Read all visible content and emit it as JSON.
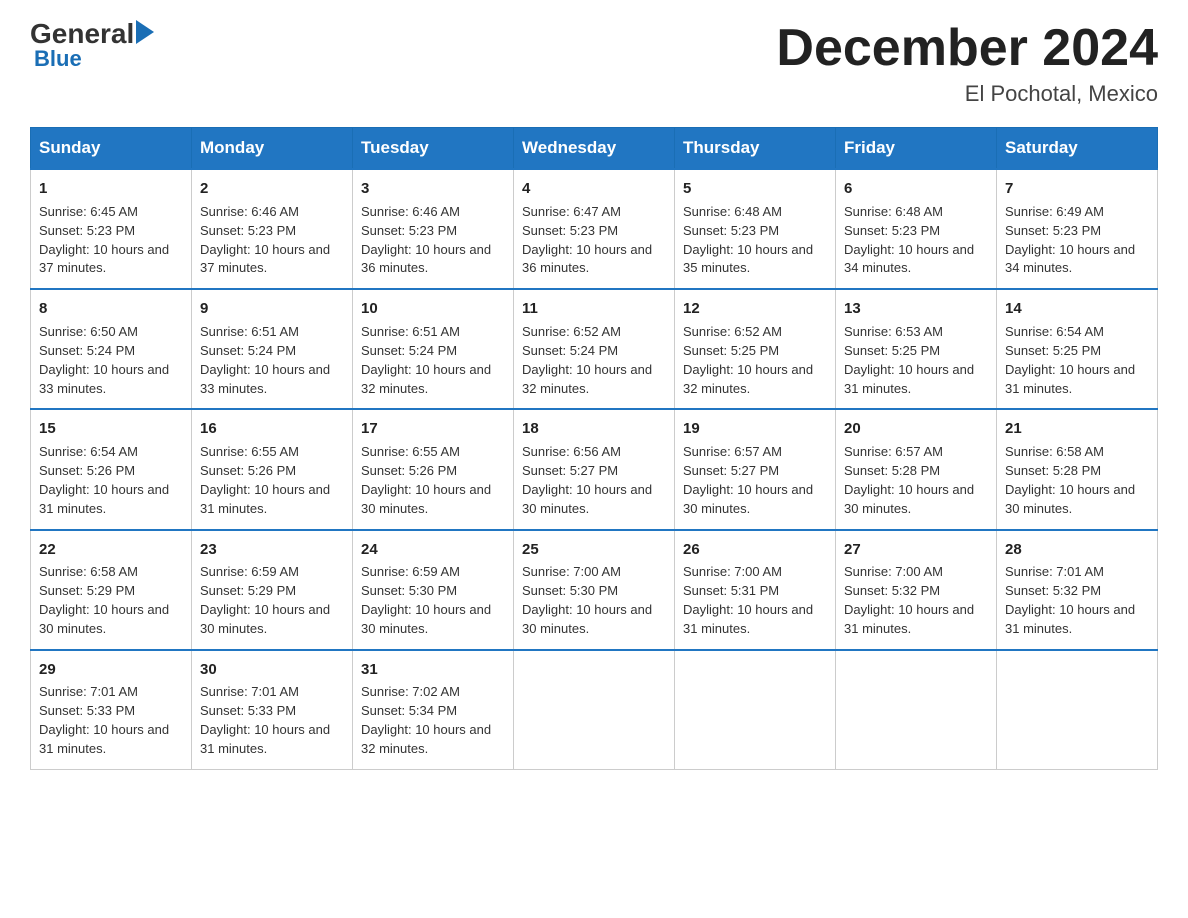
{
  "logo": {
    "general": "General",
    "blue": "Blue",
    "arrow": "▶"
  },
  "title": "December 2024",
  "location": "El Pochotal, Mexico",
  "days_of_week": [
    "Sunday",
    "Monday",
    "Tuesday",
    "Wednesday",
    "Thursday",
    "Friday",
    "Saturday"
  ],
  "weeks": [
    [
      {
        "day": "1",
        "sunrise": "6:45 AM",
        "sunset": "5:23 PM",
        "daylight": "10 hours and 37 minutes."
      },
      {
        "day": "2",
        "sunrise": "6:46 AM",
        "sunset": "5:23 PM",
        "daylight": "10 hours and 37 minutes."
      },
      {
        "day": "3",
        "sunrise": "6:46 AM",
        "sunset": "5:23 PM",
        "daylight": "10 hours and 36 minutes."
      },
      {
        "day": "4",
        "sunrise": "6:47 AM",
        "sunset": "5:23 PM",
        "daylight": "10 hours and 36 minutes."
      },
      {
        "day": "5",
        "sunrise": "6:48 AM",
        "sunset": "5:23 PM",
        "daylight": "10 hours and 35 minutes."
      },
      {
        "day": "6",
        "sunrise": "6:48 AM",
        "sunset": "5:23 PM",
        "daylight": "10 hours and 34 minutes."
      },
      {
        "day": "7",
        "sunrise": "6:49 AM",
        "sunset": "5:23 PM",
        "daylight": "10 hours and 34 minutes."
      }
    ],
    [
      {
        "day": "8",
        "sunrise": "6:50 AM",
        "sunset": "5:24 PM",
        "daylight": "10 hours and 33 minutes."
      },
      {
        "day": "9",
        "sunrise": "6:51 AM",
        "sunset": "5:24 PM",
        "daylight": "10 hours and 33 minutes."
      },
      {
        "day": "10",
        "sunrise": "6:51 AM",
        "sunset": "5:24 PM",
        "daylight": "10 hours and 32 minutes."
      },
      {
        "day": "11",
        "sunrise": "6:52 AM",
        "sunset": "5:24 PM",
        "daylight": "10 hours and 32 minutes."
      },
      {
        "day": "12",
        "sunrise": "6:52 AM",
        "sunset": "5:25 PM",
        "daylight": "10 hours and 32 minutes."
      },
      {
        "day": "13",
        "sunrise": "6:53 AM",
        "sunset": "5:25 PM",
        "daylight": "10 hours and 31 minutes."
      },
      {
        "day": "14",
        "sunrise": "6:54 AM",
        "sunset": "5:25 PM",
        "daylight": "10 hours and 31 minutes."
      }
    ],
    [
      {
        "day": "15",
        "sunrise": "6:54 AM",
        "sunset": "5:26 PM",
        "daylight": "10 hours and 31 minutes."
      },
      {
        "day": "16",
        "sunrise": "6:55 AM",
        "sunset": "5:26 PM",
        "daylight": "10 hours and 31 minutes."
      },
      {
        "day": "17",
        "sunrise": "6:55 AM",
        "sunset": "5:26 PM",
        "daylight": "10 hours and 30 minutes."
      },
      {
        "day": "18",
        "sunrise": "6:56 AM",
        "sunset": "5:27 PM",
        "daylight": "10 hours and 30 minutes."
      },
      {
        "day": "19",
        "sunrise": "6:57 AM",
        "sunset": "5:27 PM",
        "daylight": "10 hours and 30 minutes."
      },
      {
        "day": "20",
        "sunrise": "6:57 AM",
        "sunset": "5:28 PM",
        "daylight": "10 hours and 30 minutes."
      },
      {
        "day": "21",
        "sunrise": "6:58 AM",
        "sunset": "5:28 PM",
        "daylight": "10 hours and 30 minutes."
      }
    ],
    [
      {
        "day": "22",
        "sunrise": "6:58 AM",
        "sunset": "5:29 PM",
        "daylight": "10 hours and 30 minutes."
      },
      {
        "day": "23",
        "sunrise": "6:59 AM",
        "sunset": "5:29 PM",
        "daylight": "10 hours and 30 minutes."
      },
      {
        "day": "24",
        "sunrise": "6:59 AM",
        "sunset": "5:30 PM",
        "daylight": "10 hours and 30 minutes."
      },
      {
        "day": "25",
        "sunrise": "7:00 AM",
        "sunset": "5:30 PM",
        "daylight": "10 hours and 30 minutes."
      },
      {
        "day": "26",
        "sunrise": "7:00 AM",
        "sunset": "5:31 PM",
        "daylight": "10 hours and 31 minutes."
      },
      {
        "day": "27",
        "sunrise": "7:00 AM",
        "sunset": "5:32 PM",
        "daylight": "10 hours and 31 minutes."
      },
      {
        "day": "28",
        "sunrise": "7:01 AM",
        "sunset": "5:32 PM",
        "daylight": "10 hours and 31 minutes."
      }
    ],
    [
      {
        "day": "29",
        "sunrise": "7:01 AM",
        "sunset": "5:33 PM",
        "daylight": "10 hours and 31 minutes."
      },
      {
        "day": "30",
        "sunrise": "7:01 AM",
        "sunset": "5:33 PM",
        "daylight": "10 hours and 31 minutes."
      },
      {
        "day": "31",
        "sunrise": "7:02 AM",
        "sunset": "5:34 PM",
        "daylight": "10 hours and 32 minutes."
      },
      null,
      null,
      null,
      null
    ]
  ]
}
